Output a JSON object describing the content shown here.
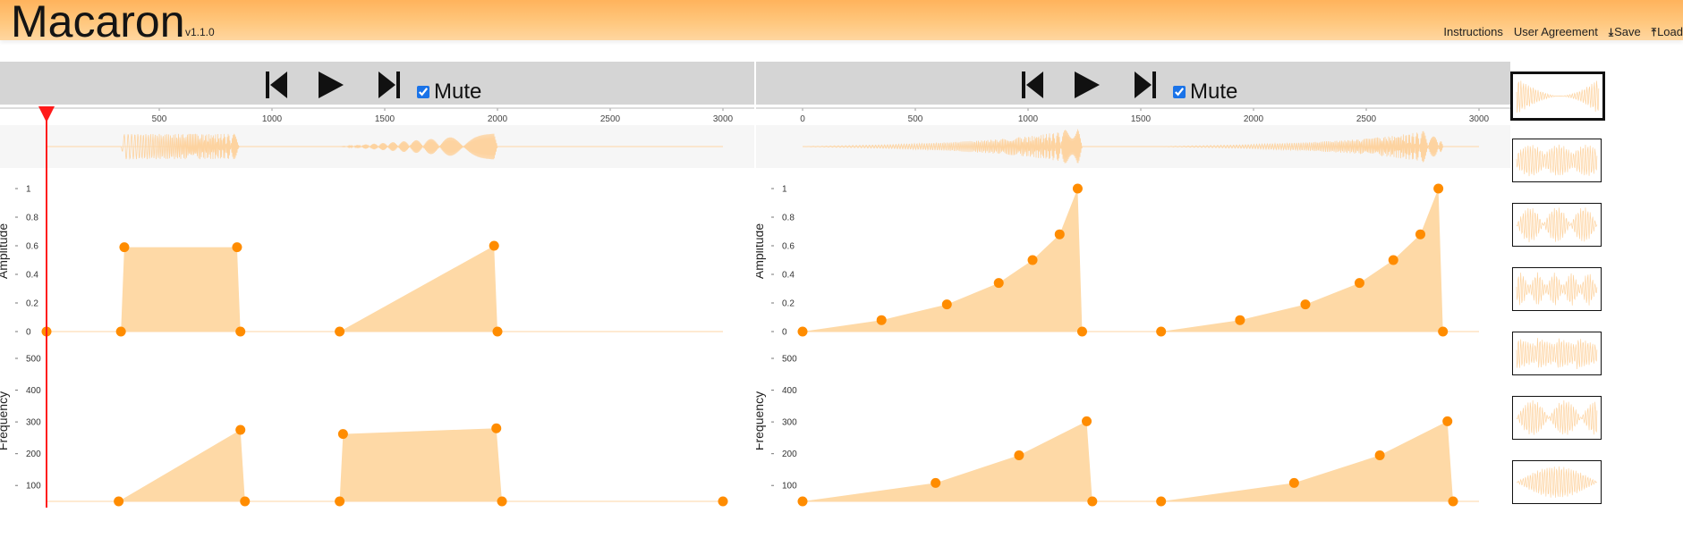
{
  "app": {
    "title": "Macaron",
    "version": "v1.1.0"
  },
  "nav": {
    "instructions": "Instructions",
    "user_agreement": "User Agreement",
    "save": "Save",
    "load": "Load"
  },
  "colors": {
    "header": "#ffbf72",
    "fill": "#fed9a6",
    "point": "#ff8c00",
    "playhead": "#ff1a1a",
    "toolbar": "#d5d5d5"
  },
  "left": {
    "mute_label": "Mute",
    "mute_checked": true,
    "time_axis": {
      "min": 0,
      "max": 3000,
      "ticks": [
        "500",
        "1000",
        "1500",
        "2000",
        "2500",
        "3000"
      ]
    },
    "playhead_ms": 0,
    "amplitude": {
      "label": "Amplitude",
      "ticks": [
        "1",
        "0.8",
        "0.6",
        "0.4",
        "0.2",
        "0"
      ],
      "range": [
        0,
        1
      ],
      "points": [
        [
          0,
          0
        ],
        [
          330,
          0
        ],
        [
          345,
          0.59
        ],
        [
          845,
          0.59
        ],
        [
          860,
          0
        ],
        [
          1300,
          0
        ],
        [
          1985,
          0.6
        ],
        [
          2000,
          0
        ]
      ]
    },
    "frequency": {
      "label": "Frequency",
      "ticks": [
        "500",
        "400",
        "300",
        "200",
        "100"
      ],
      "range": [
        50,
        500
      ],
      "points": [
        [
          320,
          50
        ],
        [
          860,
          275
        ],
        [
          880,
          50
        ],
        [
          1300,
          50
        ],
        [
          1315,
          262
        ],
        [
          1995,
          280
        ],
        [
          2020,
          50
        ],
        [
          3000,
          50
        ]
      ]
    }
  },
  "right": {
    "mute_label": "Mute",
    "mute_checked": true,
    "time_axis": {
      "min": 0,
      "max": 3000,
      "ticks": [
        "0",
        "500",
        "1000",
        "1500",
        "2000",
        "2500",
        "3000"
      ]
    },
    "amplitude": {
      "label": "Amplitude",
      "ticks": [
        "1",
        "0.8",
        "0.6",
        "0.4",
        "0.2",
        "0"
      ],
      "range": [
        0,
        1
      ],
      "points": [
        [
          0,
          0
        ],
        [
          350,
          0.08
        ],
        [
          640,
          0.19
        ],
        [
          870,
          0.34
        ],
        [
          1020,
          0.5
        ],
        [
          1140,
          0.68
        ],
        [
          1220,
          1.0
        ],
        [
          1240,
          0
        ],
        [
          1590,
          0
        ],
        [
          1940,
          0.08
        ],
        [
          2230,
          0.19
        ],
        [
          2470,
          0.34
        ],
        [
          2620,
          0.5
        ],
        [
          2740,
          0.68
        ],
        [
          2820,
          1.0
        ],
        [
          2840,
          0
        ]
      ]
    },
    "frequency": {
      "label": "Frequency",
      "ticks": [
        "500",
        "400",
        "300",
        "200",
        "100"
      ],
      "range": [
        50,
        500
      ],
      "points": [
        [
          0,
          50
        ],
        [
          590,
          108
        ],
        [
          960,
          195
        ],
        [
          1260,
          302
        ],
        [
          1285,
          50
        ],
        [
          1590,
          50
        ],
        [
          2180,
          108
        ],
        [
          2560,
          195
        ],
        [
          2860,
          302
        ],
        [
          2885,
          50
        ]
      ]
    }
  },
  "thumbnails": [
    {
      "name": "thumb-1",
      "selected": true
    },
    {
      "name": "thumb-2",
      "selected": false
    },
    {
      "name": "thumb-3",
      "selected": false
    },
    {
      "name": "thumb-4",
      "selected": false
    },
    {
      "name": "thumb-5",
      "selected": false
    },
    {
      "name": "thumb-6",
      "selected": false
    },
    {
      "name": "thumb-7",
      "selected": false
    }
  ],
  "icons": {
    "prev": "skip-back-icon",
    "play": "play-icon",
    "next": "skip-forward-icon",
    "save": "download-icon",
    "load": "upload-icon"
  }
}
